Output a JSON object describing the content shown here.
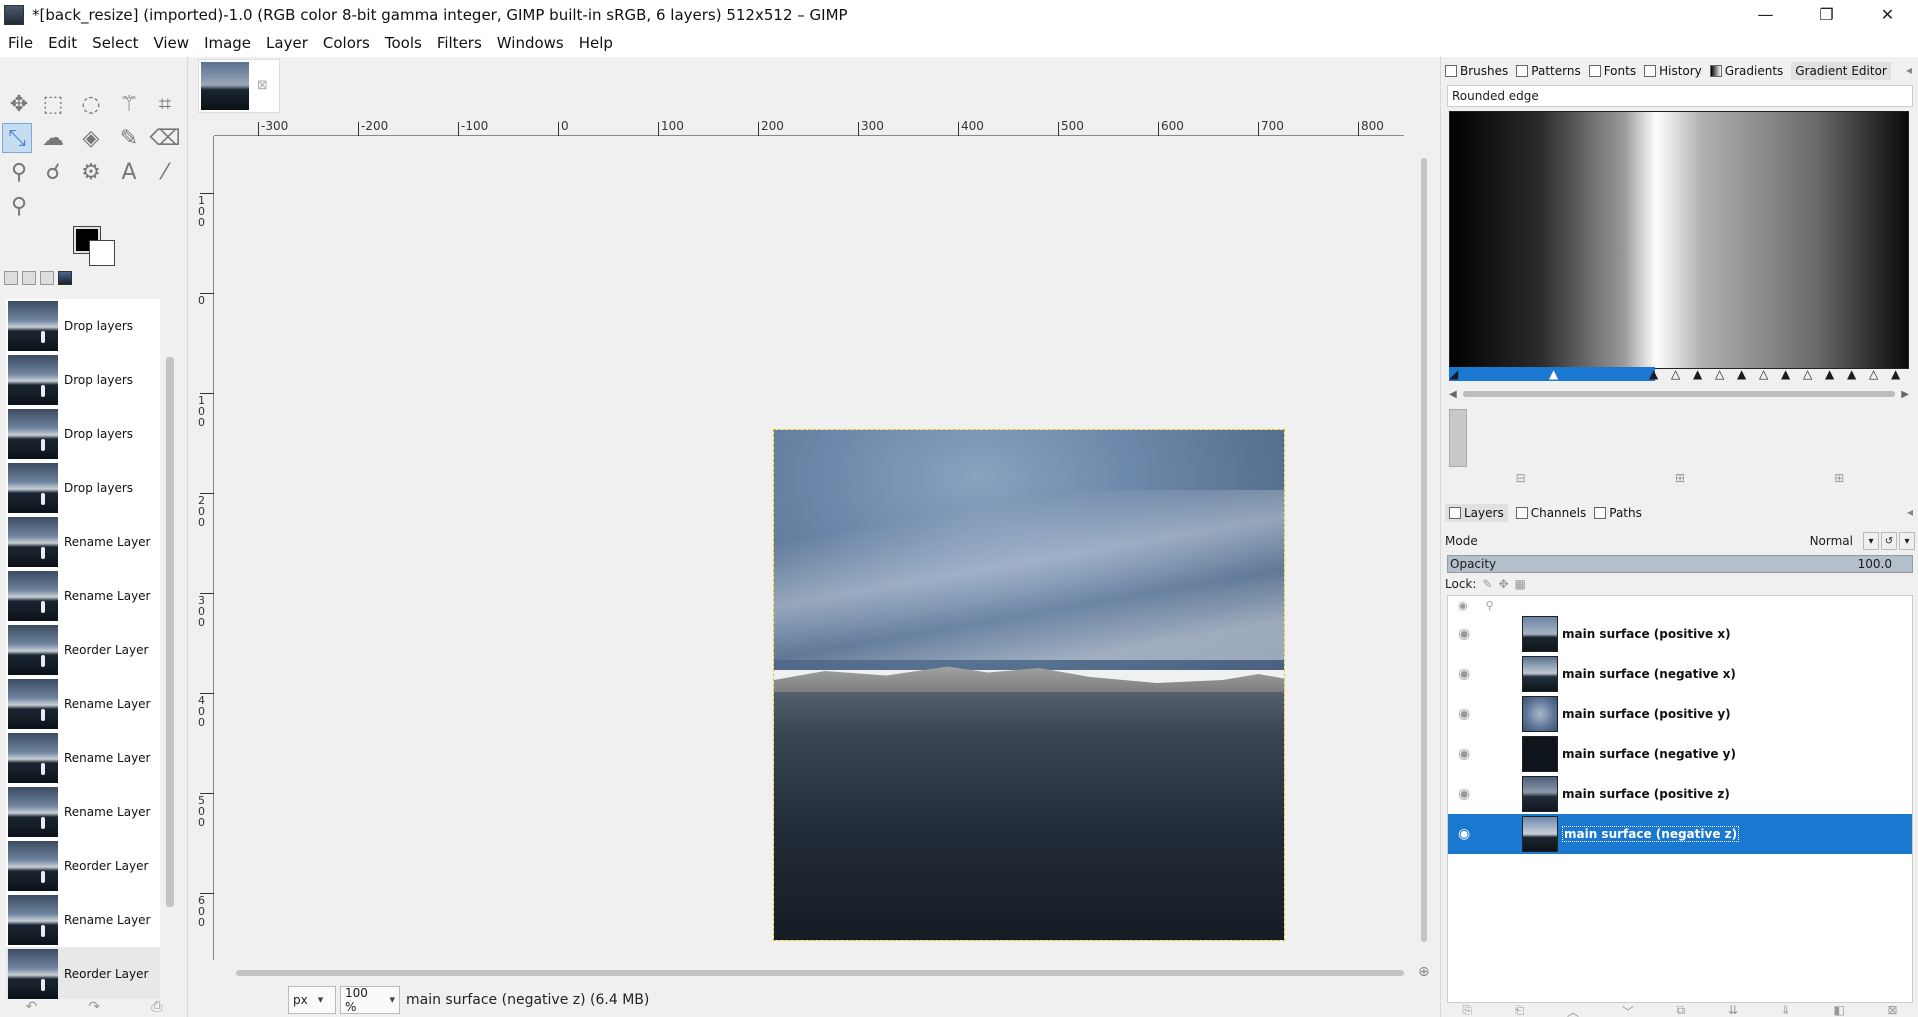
{
  "window": {
    "title": "*[back_resize] (imported)-1.0 (RGB color 8-bit gamma integer, GIMP built-in sRGB, 6 layers) 512x512 – GIMP",
    "minimize": "—",
    "maximize": "❐",
    "close": "✕"
  },
  "menu": [
    "File",
    "Edit",
    "Select",
    "View",
    "Image",
    "Layer",
    "Colors",
    "Tools",
    "Filters",
    "Windows",
    "Help"
  ],
  "undo_history": [
    "Drop layers",
    "Drop layers",
    "Drop layers",
    "Drop layers",
    "Rename Layer",
    "Rename Layer",
    "Reorder Layer",
    "Rename Layer",
    "Rename Layer",
    "Rename Layer",
    "Reorder Layer",
    "Rename Layer",
    "Reorder Layer"
  ],
  "ruler": {
    "h_labels": [
      "-300",
      "-200",
      "-100",
      "0",
      "100",
      "200",
      "300",
      "400",
      "500",
      "600",
      "700",
      "800"
    ],
    "v_labels": [
      "100",
      "0",
      "100",
      "200",
      "300",
      "400",
      "500",
      "600"
    ]
  },
  "statusbar": {
    "unit": "px",
    "zoom": "100 %",
    "message": "main surface (negative z) (6.4 MB)"
  },
  "gradient_dock": {
    "tabs": [
      "Brushes",
      "Patterns",
      "Fonts",
      "History",
      "Gradients",
      "Gradient Editor"
    ],
    "active_tab": "Gradient Editor",
    "gradient_name": "Rounded edge"
  },
  "layers_dock": {
    "tabs": [
      "Layers",
      "Channels",
      "Paths"
    ],
    "mode_label": "Mode",
    "mode_value": "Normal",
    "opacity_label": "Opacity",
    "opacity_value": "100.0",
    "lock_label": "Lock:",
    "layers": [
      {
        "name": "main surface (positive x)",
        "selected": false
      },
      {
        "name": "main surface (negative x)",
        "selected": false
      },
      {
        "name": "main surface (positive y)",
        "selected": false
      },
      {
        "name": "main surface (negative y)",
        "selected": false
      },
      {
        "name": "main surface (positive z)",
        "selected": false
      },
      {
        "name": "main surface (negative z)",
        "selected": true
      }
    ]
  },
  "colors": {
    "foreground": "#000000",
    "background": "#ffffff",
    "selection": "#1a78d0"
  }
}
